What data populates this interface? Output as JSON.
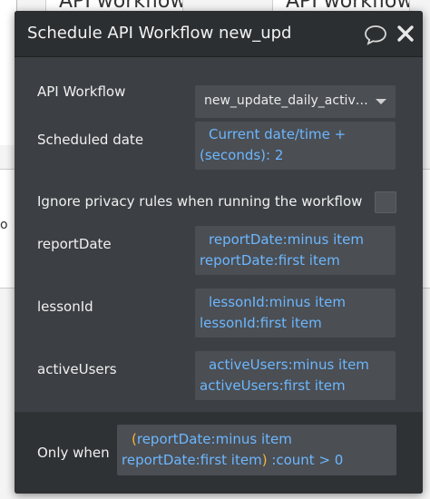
{
  "background": {
    "card_1": "API workflow",
    "card_2": "API workflow",
    "side_text": "o"
  },
  "dialog": {
    "title": "Schedule API Workflow new_update_daily_active_users",
    "fields": {
      "api_workflow": {
        "label": "API Workflow",
        "value": "new_update_daily_active_users"
      },
      "scheduled_date": {
        "label": "Scheduled date",
        "line1": "Current date/time +",
        "line2": "(seconds): 2"
      },
      "ignore_privacy": {
        "label": "Ignore privacy rules when running the workflow",
        "checked": false
      },
      "report_date": {
        "label": "reportDate",
        "line1": "reportDate:minus item",
        "line2": "reportDate:first item"
      },
      "lesson_id": {
        "label": "lessonId",
        "line1": "lessonId:minus item",
        "line2": "lessonId:first item"
      },
      "active_users": {
        "label": "activeUsers",
        "line1": "activeUsers:minus item",
        "line2": "activeUsers:first item"
      }
    },
    "only_when": {
      "label": "Only when",
      "open_paren": "(",
      "line1": "reportDate:minus item",
      "line2": "reportDate:first item",
      "close_paren": ")",
      "suffix": " :count > 0"
    }
  },
  "icons": {
    "comment": "comment-icon",
    "close": "close-icon"
  },
  "colors": {
    "panel": "#3c3f43",
    "titlebar": "#2c2f32",
    "field": "#4b4e53",
    "dynamic_text": "#6cb7ff",
    "paren": "#f3b73c"
  }
}
